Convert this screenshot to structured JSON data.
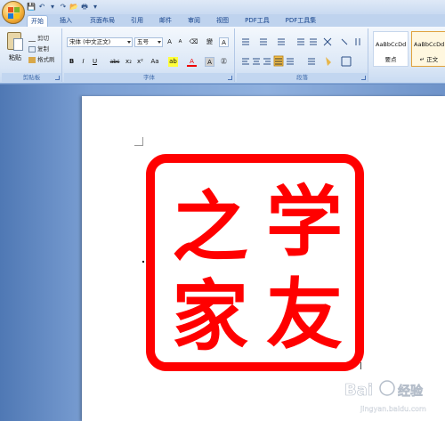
{
  "quick_access": {
    "save_icon": "save-icon",
    "undo_icon": "undo-icon",
    "redo_icon": "redo-icon",
    "open_icon": "open-icon",
    "print_icon": "print-icon"
  },
  "tabs": [
    "开始",
    "插入",
    "页面布局",
    "引用",
    "邮件",
    "审阅",
    "视图",
    "PDF工具",
    "PDF工具集"
  ],
  "clipboard": {
    "paste": "粘贴",
    "cut": "剪切",
    "copy": "复制",
    "format_painter": "格式刷",
    "label": "剪贴板"
  },
  "font": {
    "family": "宋体 (中文正文)",
    "size": "五号",
    "grow": "A",
    "shrink": "A",
    "clear": "⌫",
    "phonetic": "變",
    "border": "A",
    "bold": "B",
    "italic": "I",
    "underline": "U",
    "strike": "abc",
    "subscript": "x₂",
    "superscript": "x²",
    "change_case": "Aa",
    "highlight": "ab",
    "color": "A",
    "shading": "A",
    "enclose": "㊣",
    "label": "字体"
  },
  "paragraph": {
    "label": "段落"
  },
  "styles": [
    {
      "sample": "AaBbCcDd",
      "name": "要点"
    },
    {
      "sample": "AaBbCcDd",
      "name": "↵ 正文"
    }
  ],
  "document": {
    "seal_chars": [
      "学",
      "之",
      "友",
      "家"
    ],
    "seal_color": "#ff0000"
  },
  "watermark": {
    "brand": "Bai",
    "brand2": "经验",
    "url": "jingyan.baidu.com"
  }
}
